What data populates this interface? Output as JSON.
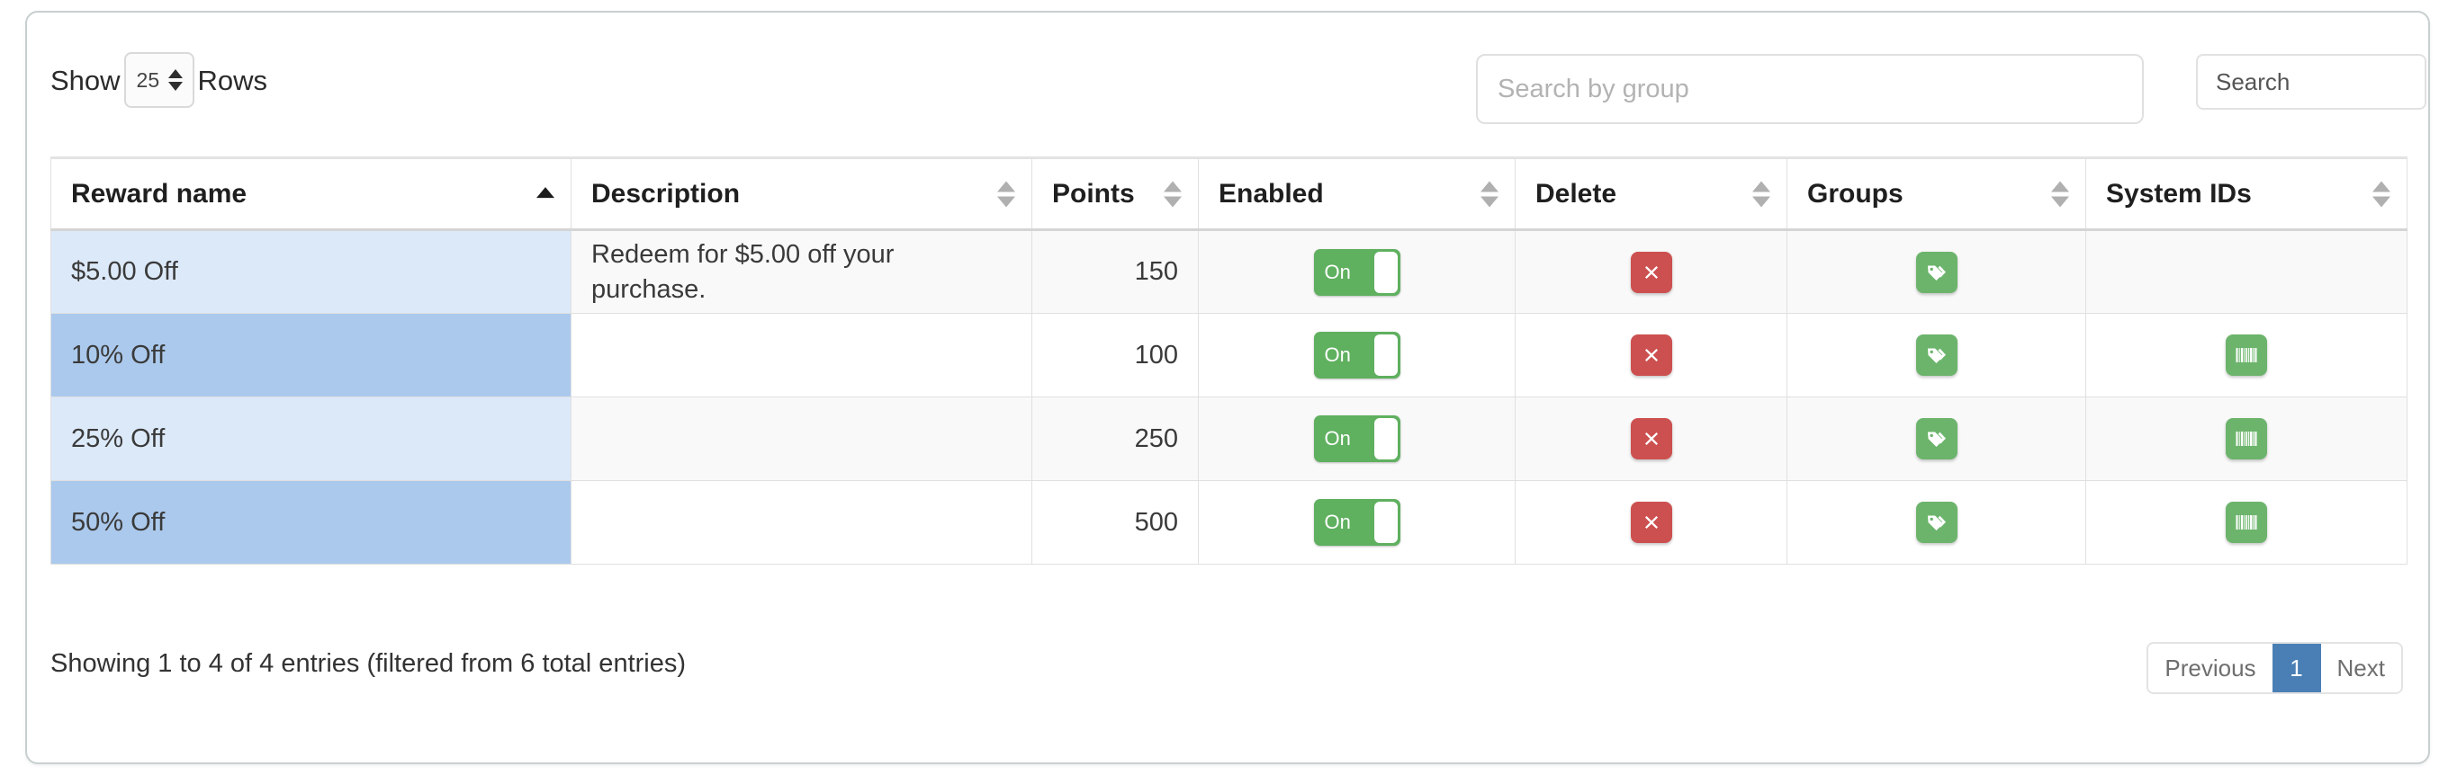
{
  "controls": {
    "show_label": "Show",
    "rows_value": "25",
    "rows_suffix": "Rows",
    "group_search_placeholder": "Search by group",
    "group_search_value": "",
    "search_button_label": "Search"
  },
  "table": {
    "columns": [
      {
        "label": "Reward name",
        "sort": "asc"
      },
      {
        "label": "Description",
        "sort": "none"
      },
      {
        "label": "Points",
        "sort": "none"
      },
      {
        "label": "Enabled",
        "sort": "none"
      },
      {
        "label": "Delete",
        "sort": "none"
      },
      {
        "label": "Groups",
        "sort": "none"
      },
      {
        "label": "System IDs",
        "sort": "none"
      }
    ],
    "rows": [
      {
        "name": "$5.00 Off",
        "description": "Redeem for $5.00 off your purchase.",
        "points": "150",
        "enabled_label": "On",
        "delete_icon": "x-icon",
        "groups_icon": "tags-icon",
        "system_ids_icon": ""
      },
      {
        "name": "10% Off",
        "description": "",
        "points": "100",
        "enabled_label": "On",
        "delete_icon": "x-icon",
        "groups_icon": "tags-icon",
        "system_ids_icon": "barcode-icon"
      },
      {
        "name": "25% Off",
        "description": "",
        "points": "250",
        "enabled_label": "On",
        "delete_icon": "x-icon",
        "groups_icon": "tags-icon",
        "system_ids_icon": "barcode-icon"
      },
      {
        "name": "50% Off",
        "description": "",
        "points": "500",
        "enabled_label": "On",
        "delete_icon": "x-icon",
        "groups_icon": "tags-icon",
        "system_ids_icon": "barcode-icon"
      }
    ]
  },
  "footer": {
    "info": "Showing 1 to 4 of 4 entries (filtered from 6 total entries)",
    "previous_label": "Previous",
    "page_label": "1",
    "next_label": "Next"
  },
  "colors": {
    "toggle_on": "#5fb05f",
    "delete_button": "#cd5050",
    "action_green": "#6cb46c",
    "active_page": "#4a7fb5",
    "sorted_cell_odd": "#dce9f9",
    "sorted_cell_even": "#abc9ec"
  }
}
